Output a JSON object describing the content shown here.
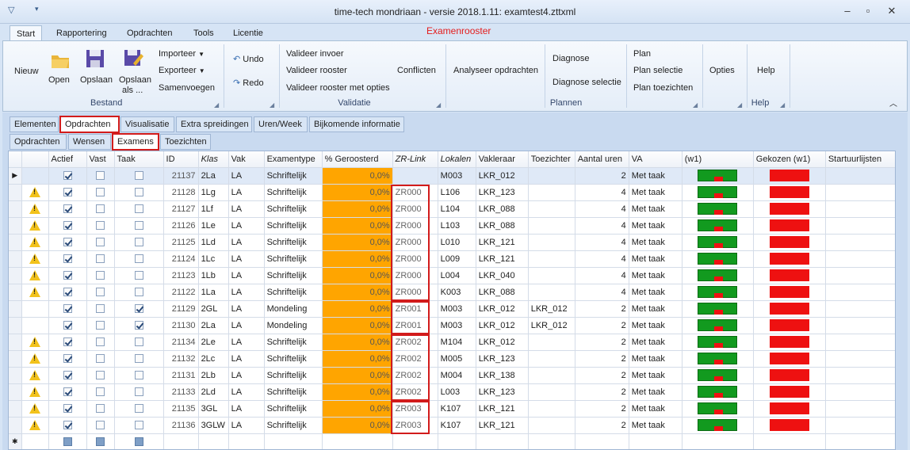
{
  "window": {
    "title": "time-tech mondriaan - versie 2018.1.11: examtest4.zttxml",
    "context_label": "Examenrooster"
  },
  "ribbon_tabs": [
    "Start",
    "Rapportering",
    "Opdrachten",
    "Tools",
    "Licentie"
  ],
  "ribbon": {
    "nieuw": "Nieuw",
    "open": "Open",
    "opslaan": "Opslaan",
    "opslaan_als_1": "Opslaan",
    "opslaan_als_2": "als ...",
    "importeer": "Importeer",
    "exporteer": "Exporteer",
    "samenvoegen": "Samenvoegen",
    "bestand": "Bestand",
    "undo": "Undo",
    "redo": "Redo",
    "valideer_invoer": "Valideer invoer",
    "valideer_rooster": "Valideer rooster",
    "valideer_opties": "Valideer rooster met opties",
    "conflicten": "Conflicten",
    "validatie": "Validatie",
    "analyseer": "Analyseer opdrachten",
    "diagnose": "Diagnose",
    "diagnose_selectie": "Diagnose selectie",
    "plan": "Plan",
    "plan_selectie": "Plan selectie",
    "plan_toezichten": "Plan toezichten",
    "plannen": "Plannen",
    "opties": "Opties",
    "help": "Help",
    "help_group": "Help"
  },
  "main_tabs": [
    "Elementen",
    "Opdrachten",
    "Visualisatie",
    "Extra spreidingen",
    "Uren/Week",
    "Bijkomende informatie"
  ],
  "sub_tabs": [
    "Opdrachten",
    "Wensen",
    "Examens",
    "Toezichten"
  ],
  "columns": [
    "",
    "Actief",
    "Vast",
    "Taak",
    "ID",
    "Klas",
    "Vak",
    "Examentype",
    "% Geroosterd",
    "ZR-Link",
    "Lokalen",
    "Vakleraar",
    "Toezichter",
    "Aantal uren",
    "VA",
    "(w1)",
    "Gekozen (w1)",
    "Startuurlijsten"
  ],
  "rows": [
    {
      "warn": false,
      "actief": true,
      "vast": false,
      "taak": false,
      "id": "21137",
      "klas": "2La",
      "vak": "LA",
      "type": "Schriftelijk",
      "pct": "0,0%",
      "zr": "",
      "lokaal": "M003",
      "leraar": "LKR_012",
      "toezichter": "",
      "uren": "2",
      "va": "Met taak"
    },
    {
      "warn": true,
      "actief": true,
      "vast": false,
      "taak": false,
      "id": "21128",
      "klas": "1Lg",
      "vak": "LA",
      "type": "Schriftelijk",
      "pct": "0,0%",
      "zr": "ZR000",
      "lokaal": "L106",
      "leraar": "LKR_123",
      "toezichter": "",
      "uren": "4",
      "va": "Met taak"
    },
    {
      "warn": true,
      "actief": true,
      "vast": false,
      "taak": false,
      "id": "21127",
      "klas": "1Lf",
      "vak": "LA",
      "type": "Schriftelijk",
      "pct": "0,0%",
      "zr": "ZR000",
      "lokaal": "L104",
      "leraar": "LKR_088",
      "toezichter": "",
      "uren": "4",
      "va": "Met taak"
    },
    {
      "warn": true,
      "actief": true,
      "vast": false,
      "taak": false,
      "id": "21126",
      "klas": "1Le",
      "vak": "LA",
      "type": "Schriftelijk",
      "pct": "0,0%",
      "zr": "ZR000",
      "lokaal": "L103",
      "leraar": "LKR_088",
      "toezichter": "",
      "uren": "4",
      "va": "Met taak"
    },
    {
      "warn": true,
      "actief": true,
      "vast": false,
      "taak": false,
      "id": "21125",
      "klas": "1Ld",
      "vak": "LA",
      "type": "Schriftelijk",
      "pct": "0,0%",
      "zr": "ZR000",
      "lokaal": "L010",
      "leraar": "LKR_121",
      "toezichter": "",
      "uren": "4",
      "va": "Met taak"
    },
    {
      "warn": true,
      "actief": true,
      "vast": false,
      "taak": false,
      "id": "21124",
      "klas": "1Lc",
      "vak": "LA",
      "type": "Schriftelijk",
      "pct": "0,0%",
      "zr": "ZR000",
      "lokaal": "L009",
      "leraar": "LKR_121",
      "toezichter": "",
      "uren": "4",
      "va": "Met taak"
    },
    {
      "warn": true,
      "actief": true,
      "vast": false,
      "taak": false,
      "id": "21123",
      "klas": "1Lb",
      "vak": "LA",
      "type": "Schriftelijk",
      "pct": "0,0%",
      "zr": "ZR000",
      "lokaal": "L004",
      "leraar": "LKR_040",
      "toezichter": "",
      "uren": "4",
      "va": "Met taak"
    },
    {
      "warn": true,
      "actief": true,
      "vast": false,
      "taak": false,
      "id": "21122",
      "klas": "1La",
      "vak": "LA",
      "type": "Schriftelijk",
      "pct": "0,0%",
      "zr": "ZR000",
      "lokaal": "K003",
      "leraar": "LKR_088",
      "toezichter": "",
      "uren": "4",
      "va": "Met taak"
    },
    {
      "warn": false,
      "actief": true,
      "vast": false,
      "taak": true,
      "id": "21129",
      "klas": "2GL",
      "vak": "LA",
      "type": "Mondeling",
      "pct": "0,0%",
      "zr": "ZR001",
      "lokaal": "M003",
      "leraar": "LKR_012",
      "toezichter": "LKR_012",
      "uren": "2",
      "va": "Met taak"
    },
    {
      "warn": false,
      "actief": true,
      "vast": false,
      "taak": true,
      "id": "21130",
      "klas": "2La",
      "vak": "LA",
      "type": "Mondeling",
      "pct": "0,0%",
      "zr": "ZR001",
      "lokaal": "M003",
      "leraar": "LKR_012",
      "toezichter": "LKR_012",
      "uren": "2",
      "va": "Met taak"
    },
    {
      "warn": true,
      "actief": true,
      "vast": false,
      "taak": false,
      "id": "21134",
      "klas": "2Le",
      "vak": "LA",
      "type": "Schriftelijk",
      "pct": "0,0%",
      "zr": "ZR002",
      "lokaal": "M104",
      "leraar": "LKR_012",
      "toezichter": "",
      "uren": "2",
      "va": "Met taak"
    },
    {
      "warn": true,
      "actief": true,
      "vast": false,
      "taak": false,
      "id": "21132",
      "klas": "2Lc",
      "vak": "LA",
      "type": "Schriftelijk",
      "pct": "0,0%",
      "zr": "ZR002",
      "lokaal": "M005",
      "leraar": "LKR_123",
      "toezichter": "",
      "uren": "2",
      "va": "Met taak"
    },
    {
      "warn": true,
      "actief": true,
      "vast": false,
      "taak": false,
      "id": "21131",
      "klas": "2Lb",
      "vak": "LA",
      "type": "Schriftelijk",
      "pct": "0,0%",
      "zr": "ZR002",
      "lokaal": "M004",
      "leraar": "LKR_138",
      "toezichter": "",
      "uren": "2",
      "va": "Met taak"
    },
    {
      "warn": true,
      "actief": true,
      "vast": false,
      "taak": false,
      "id": "21133",
      "klas": "2Ld",
      "vak": "LA",
      "type": "Schriftelijk",
      "pct": "0,0%",
      "zr": "ZR002",
      "lokaal": "L003",
      "leraar": "LKR_123",
      "toezichter": "",
      "uren": "2",
      "va": "Met taak"
    },
    {
      "warn": true,
      "actief": true,
      "vast": false,
      "taak": false,
      "id": "21135",
      "klas": "3GL",
      "vak": "LA",
      "type": "Schriftelijk",
      "pct": "0,0%",
      "zr": "ZR003",
      "lokaal": "K107",
      "leraar": "LKR_121",
      "toezichter": "",
      "uren": "2",
      "va": "Met taak"
    },
    {
      "warn": true,
      "actief": true,
      "vast": false,
      "taak": false,
      "id": "21136",
      "klas": "3GLW",
      "vak": "LA",
      "type": "Schriftelijk",
      "pct": "0,0%",
      "zr": "ZR003",
      "lokaal": "K107",
      "leraar": "LKR_121",
      "toezichter": "",
      "uren": "2",
      "va": "Met taak"
    }
  ],
  "colors": {
    "accent": "#e41c1c",
    "orange": "#ffa500",
    "green": "#129a1f",
    "red": "#ee1111"
  }
}
